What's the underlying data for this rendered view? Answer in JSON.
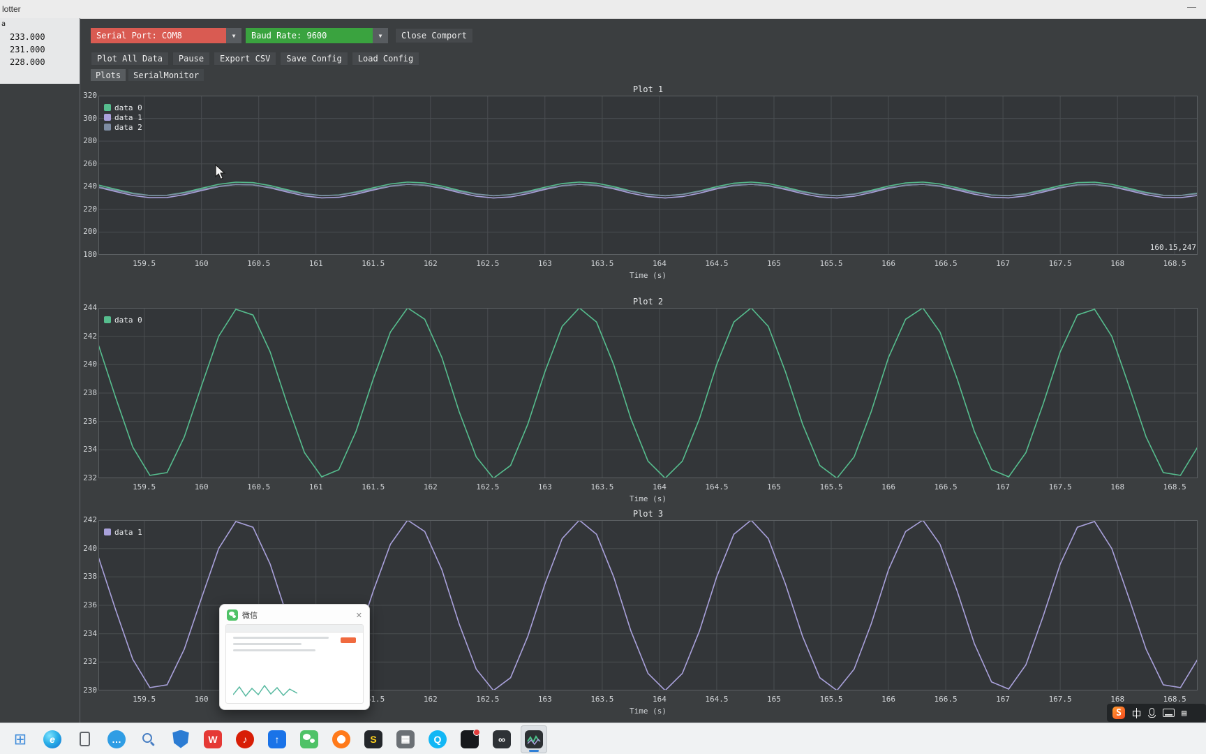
{
  "window": {
    "title": "lotter",
    "minimize_icon": "—"
  },
  "sidebar": {
    "header": "a",
    "values": [
      "233.000",
      "231.000",
      "228.000"
    ]
  },
  "toolbar": {
    "serial_port": {
      "label": "Serial Port: COM8",
      "color": "#d95b52"
    },
    "baud_rate": {
      "label": "Baud Rate: 9600",
      "color": "#3aa33f"
    },
    "close_button": "Close Comport",
    "actions": [
      "Plot All Data",
      "Pause",
      "Export CSV",
      "Save Config",
      "Load Config"
    ],
    "dropdown_arrow": "▼"
  },
  "tabs": [
    {
      "label": "Plots",
      "active": true
    },
    {
      "label": "SerialMonitor",
      "active": false
    }
  ],
  "chart_data": {
    "type": "line",
    "xlabel": "Time (s)",
    "xlim": [
      159.1,
      168.7
    ],
    "xtick_values": [
      159.5,
      160,
      160.5,
      161,
      161.5,
      162,
      162.5,
      163,
      163.5,
      164,
      164.5,
      165,
      165.5,
      166,
      166.5,
      167,
      167.5,
      168,
      168.5
    ],
    "xtick_labels": [
      "159.5",
      "160",
      "160.5",
      "161",
      "161.5",
      "162",
      "162.5",
      "163",
      "163.5",
      "164",
      "164.5",
      "165",
      "165.5",
      "166",
      "166.5",
      "167",
      "167.5",
      "168",
      "168.5"
    ],
    "x": [
      159.1,
      159.25,
      159.4,
      159.55,
      159.7,
      159.85,
      160,
      160.15,
      160.3,
      160.45,
      160.6,
      160.75,
      160.9,
      161.05,
      161.2,
      161.35,
      161.5,
      161.65,
      161.8,
      161.95,
      162.1,
      162.25,
      162.4,
      162.55,
      162.7,
      162.85,
      163,
      163.15,
      163.3,
      163.45,
      163.6,
      163.75,
      163.9,
      164.05,
      164.2,
      164.35,
      164.5,
      164.65,
      164.8,
      164.95,
      165.1,
      165.25,
      165.4,
      165.55,
      165.7,
      165.85,
      166,
      166.15,
      166.3,
      166.45,
      166.6,
      166.75,
      166.9,
      167.05,
      167.2,
      167.35,
      167.5,
      167.65,
      167.8,
      167.95,
      168.1,
      168.25,
      168.4,
      168.55,
      168.7
    ],
    "series_colors": {
      "data 0": "#56bd8e",
      "data 1": "#a9a1db",
      "data 2": "#7e8ca3"
    },
    "series": {
      "data 0": [
        241.4,
        237.7,
        234.2,
        232.2,
        232.4,
        234.9,
        238.5,
        242.0,
        243.9,
        243.5,
        240.9,
        237.2,
        233.8,
        232.1,
        232.6,
        235.3,
        239.0,
        242.3,
        244.0,
        243.2,
        240.5,
        236.7,
        233.5,
        232.0,
        232.9,
        235.8,
        239.5,
        242.7,
        244.0,
        243.0,
        240.0,
        236.2,
        233.2,
        232.0,
        233.2,
        236.2,
        240.0,
        243.0,
        244.0,
        242.7,
        239.5,
        235.8,
        232.9,
        232.0,
        233.5,
        236.7,
        240.5,
        243.2,
        244.0,
        242.3,
        239.0,
        235.3,
        232.6,
        232.1,
        233.8,
        237.2,
        240.9,
        243.5,
        243.9,
        242.0,
        238.5,
        234.9,
        232.4,
        232.2,
        234.2
      ],
      "data 1": [
        239.4,
        235.7,
        232.2,
        230.2,
        230.4,
        232.9,
        236.5,
        240.0,
        241.9,
        241.5,
        238.9,
        235.2,
        231.8,
        230.1,
        230.6,
        233.3,
        237.0,
        240.3,
        242.0,
        241.2,
        238.5,
        234.7,
        231.5,
        230.0,
        230.9,
        233.8,
        237.5,
        240.7,
        242.0,
        241.0,
        238.0,
        234.2,
        231.2,
        230.0,
        231.2,
        234.2,
        238.0,
        241.0,
        242.0,
        240.7,
        237.5,
        233.8,
        230.9,
        230.0,
        231.5,
        234.7,
        238.5,
        241.2,
        242.0,
        240.3,
        237.0,
        233.3,
        230.6,
        230.1,
        231.8,
        235.2,
        238.9,
        241.5,
        241.9,
        240.0,
        236.5,
        232.9,
        230.4,
        230.2,
        232.2
      ],
      "data 2": [
        239.8,
        236.8,
        233.8,
        232.2,
        232.3,
        234.4,
        237.4,
        240.3,
        241.9,
        241.6,
        239.4,
        236.3,
        233.5,
        232.1,
        232.5,
        234.8,
        237.8,
        240.6,
        242.0,
        241.3,
        239.1,
        235.9,
        233.3,
        232.0,
        232.8,
        235.2,
        238.3,
        240.9,
        242.0,
        241.2,
        238.7,
        235.8,
        233.0,
        232.0,
        233.0,
        235.8,
        238.7,
        241.2,
        242.0,
        240.9,
        238.3,
        235.2,
        232.8,
        232.0,
        233.3,
        235.9,
        239.1,
        241.3,
        242.0,
        240.6,
        237.8,
        234.8,
        232.5,
        232.1,
        233.5,
        236.3,
        239.4,
        241.6,
        241.9,
        240.3,
        237.4,
        234.4,
        232.3,
        232.2,
        233.8
      ]
    },
    "plots": [
      {
        "title": "Plot 1",
        "xlabel": "Time (s)",
        "ylim": [
          180,
          320
        ],
        "ytick_values": [
          180,
          200,
          220,
          240,
          260,
          280,
          300,
          320
        ],
        "ytick_labels": [
          "180",
          "200",
          "220",
          "240",
          "260",
          "280",
          "300",
          "320"
        ],
        "series": [
          "data 0",
          "data 1",
          "data 2"
        ],
        "cursor_readout": "160.15,247"
      },
      {
        "title": "Plot 2",
        "xlabel": "Time (s)",
        "ylim": [
          232,
          244
        ],
        "ytick_values": [
          232,
          234,
          236,
          238,
          240,
          242,
          244
        ],
        "ytick_labels": [
          "232",
          "234",
          "236",
          "238",
          "240",
          "242",
          "244"
        ],
        "series": [
          "data 0"
        ]
      },
      {
        "title": "Plot 3",
        "xlabel": "Time (s)",
        "ylim": [
          230,
          242
        ],
        "ytick_values": [
          230,
          232,
          234,
          236,
          238,
          240,
          242
        ],
        "ytick_labels": [
          "230",
          "232",
          "234",
          "236",
          "238",
          "240",
          "242"
        ],
        "series": [
          "data 1"
        ]
      }
    ]
  },
  "preview_popup": {
    "title": "微信",
    "close_icon": "✕"
  },
  "ime_bar": {
    "logo": "S",
    "mode": "中"
  },
  "taskbar": {
    "icons": [
      {
        "name": "start",
        "glyph": "⊞",
        "bg": "none",
        "fg": "#3f8cda"
      },
      {
        "name": "edge",
        "glyph": "e",
        "bg": "edge",
        "fg": "#ffffff"
      },
      {
        "name": "phone-link",
        "glyph": "",
        "bg": "phone",
        "fg": "#5f6368"
      },
      {
        "name": "teams-chat",
        "glyph": "…",
        "bg": "#2f9de4",
        "fg": "#ffffff",
        "shape": "circle"
      },
      {
        "name": "search",
        "glyph": "",
        "bg": "search",
        "fg": "#4a80c4"
      },
      {
        "name": "security-shield",
        "glyph": "",
        "bg": "shield",
        "fg": "#ffffff"
      },
      {
        "name": "wps",
        "glyph": "W",
        "bg": "#e53935",
        "fg": "#ffffff"
      },
      {
        "name": "music",
        "glyph": "♪",
        "bg": "#d81e06",
        "fg": "#ffffff",
        "shape": "circle"
      },
      {
        "name": "netdisk",
        "glyph": "↑",
        "bg": "#1a73e8",
        "fg": "#ffffff"
      },
      {
        "name": "wechat",
        "glyph": "",
        "bg": "wechat",
        "fg": "#ffffff"
      },
      {
        "name": "browser-orange",
        "glyph": "",
        "bg": "donut",
        "fg": "#ff7a1a"
      },
      {
        "name": "flash",
        "glyph": "S",
        "bg": "#23272b",
        "fg": "#ffd21e"
      },
      {
        "name": "calculator",
        "glyph": "▦",
        "bg": "#6b7075",
        "fg": "#ffffff"
      },
      {
        "name": "qq",
        "glyph": "Q",
        "bg": "#12b7f5",
        "fg": "#ffffff",
        "shape": "circle"
      },
      {
        "name": "ide",
        "glyph": "",
        "bg": "ide",
        "fg": "#ffffff"
      },
      {
        "name": "infinity-app",
        "glyph": "∞",
        "bg": "#2e3236",
        "fg": "#ffffff"
      },
      {
        "name": "serial-plotter",
        "glyph": "",
        "bg": "plotter",
        "fg": "#4cc38a",
        "active": true
      }
    ]
  }
}
